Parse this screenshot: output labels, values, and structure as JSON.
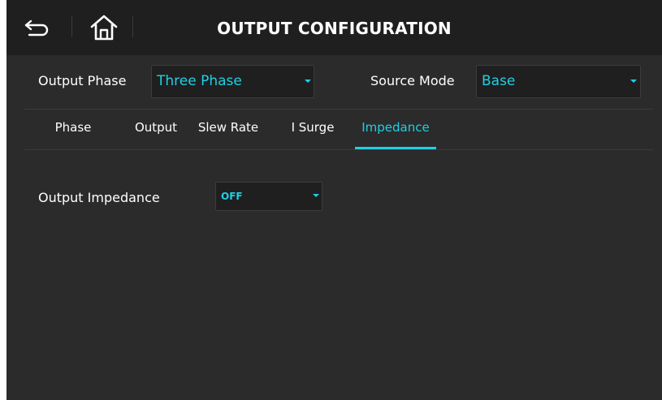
{
  "header": {
    "title": "OUTPUT CONFIGURATION"
  },
  "settings": {
    "output_phase": {
      "label": "Output Phase",
      "value": "Three Phase"
    },
    "source_mode": {
      "label": "Source Mode",
      "value": "Base"
    }
  },
  "tabs": [
    {
      "label": "Phase",
      "active": false
    },
    {
      "label": "Output",
      "active": false
    },
    {
      "label": "Slew Rate",
      "active": false
    },
    {
      "label": "I Surge",
      "active": false
    },
    {
      "label": "Impedance",
      "active": true
    }
  ],
  "impedance": {
    "label": "Output Impedance",
    "value": "OFF"
  },
  "colors": {
    "accent": "#1fd0e6",
    "background": "#2b2b2b",
    "header": "#1f1f1f"
  }
}
